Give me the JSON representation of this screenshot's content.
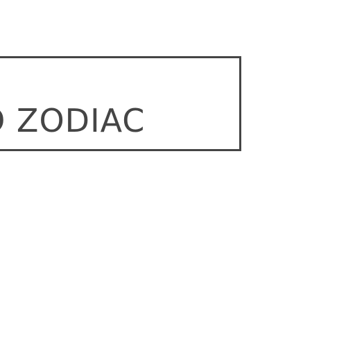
{
  "label": {
    "text": "TO ZODIAC"
  },
  "colors": {
    "border": "#454545",
    "text": "#454545",
    "background": "#ffffff"
  }
}
